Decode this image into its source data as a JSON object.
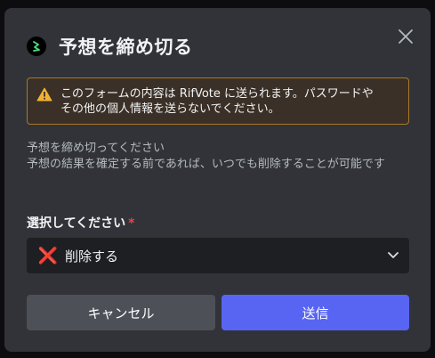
{
  "modal": {
    "title": "予想を締め切る",
    "close_icon": "close-icon",
    "app_icon": "rifvote-logo-icon"
  },
  "warning": {
    "icon": "warning-triangle-icon",
    "line1": "このフォームの内容は RifVote に送られます。パスワードや",
    "line2": "その他の個人情報を送らないでください。"
  },
  "description": {
    "line1": "予想を締め切ってください",
    "line2": "予想の結果を確定する前であれば、いつでも削除することが可能です"
  },
  "field": {
    "label": "選択してください",
    "required_mark": "*",
    "selected_icon": "❌",
    "selected_value": "削除する",
    "chevron_icon": "chevron-down-icon"
  },
  "buttons": {
    "cancel_label": "キャンセル",
    "submit_label": "送信"
  },
  "colors": {
    "background": "#313338",
    "accent": "#5865f2",
    "warning_border": "#a8782b",
    "required": "#f23f43"
  }
}
